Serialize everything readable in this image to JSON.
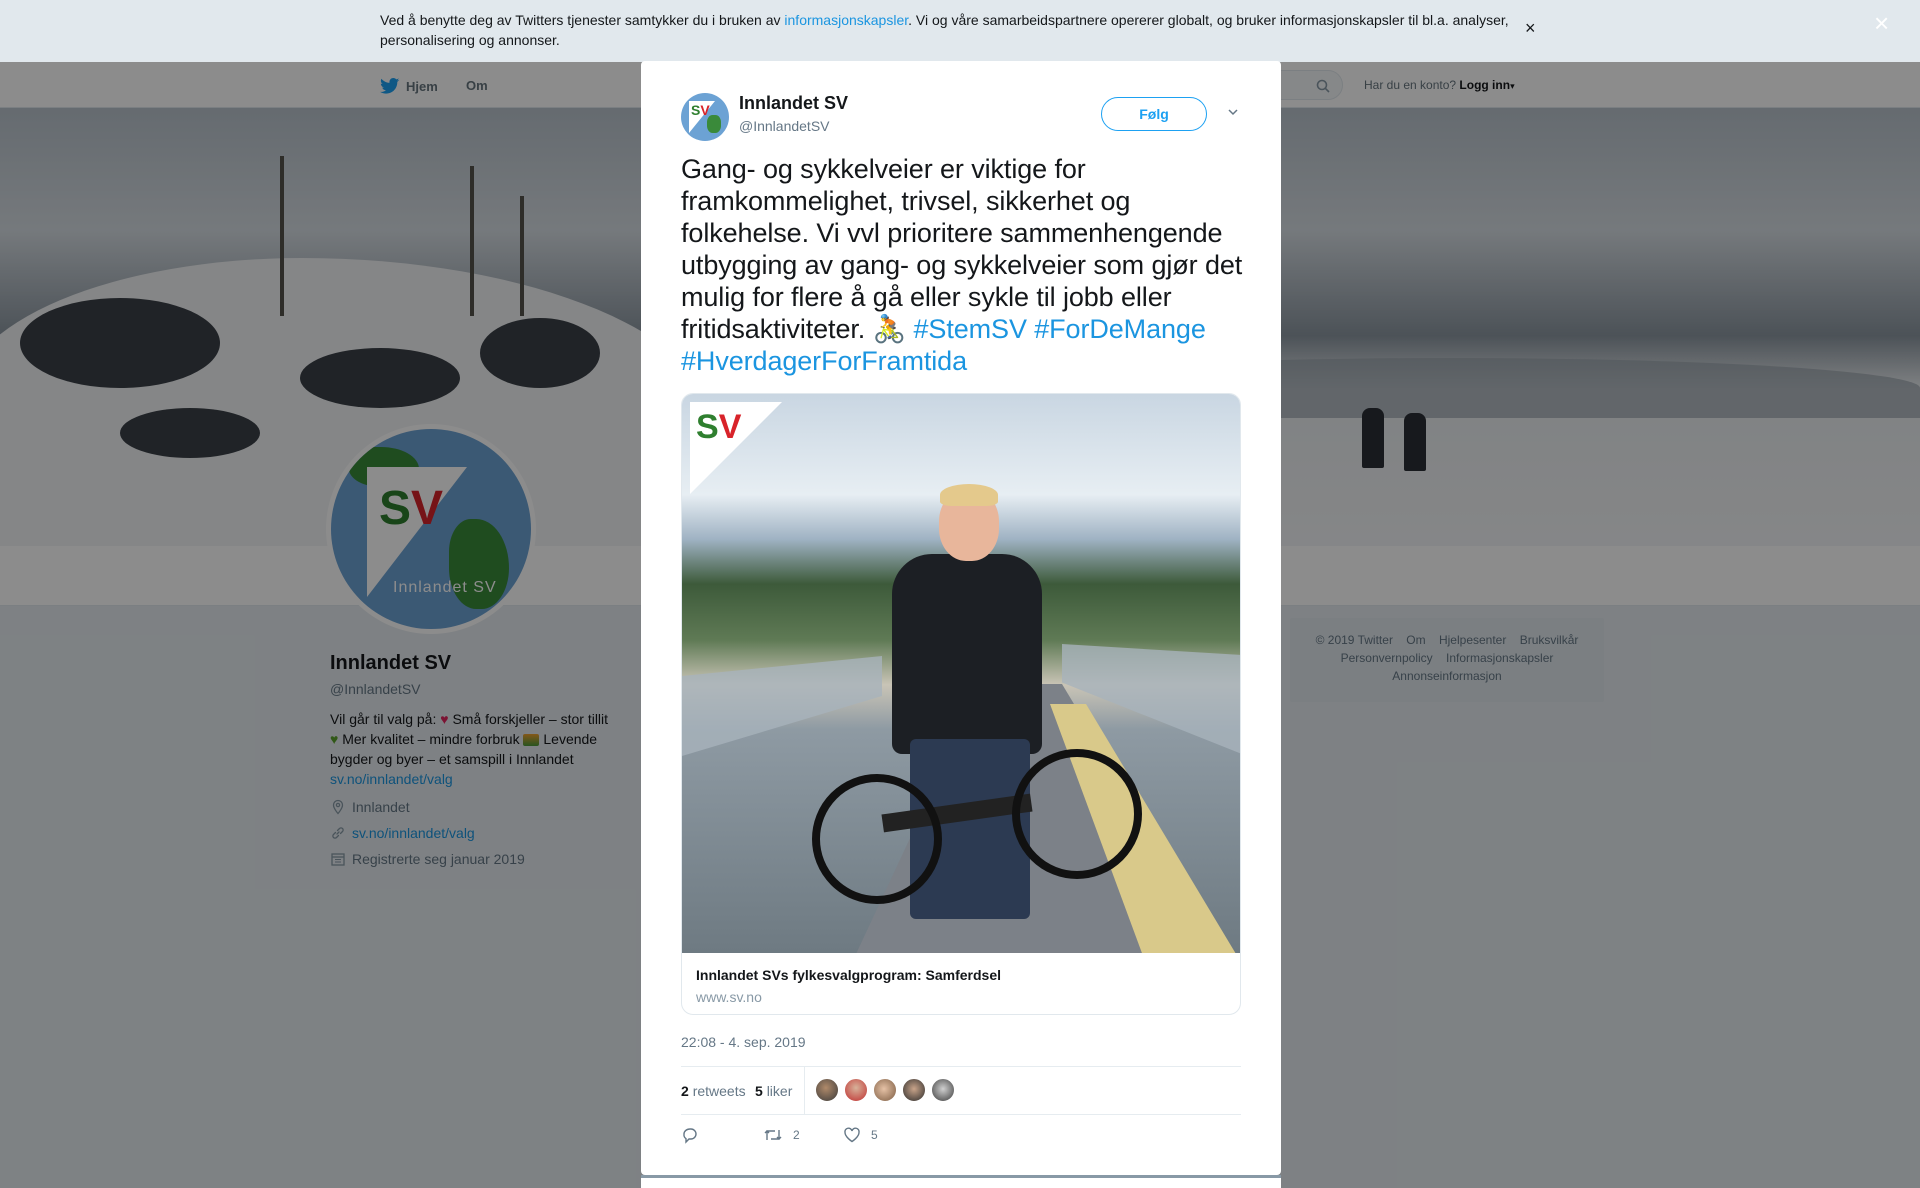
{
  "cookie": {
    "text_before": "Ved å benytte deg av Twitters tjenester samtykker du i bruken av ",
    "link": "informasjonskapsler",
    "text_after": ". Vi og våre samarbeidspartnere opererer globalt, og bruker informasjonskapsler til bl.a. analyser, personalisering og annonser.",
    "close": "×"
  },
  "nav": {
    "home": "Hjem",
    "about": "Om",
    "login_prompt": "Har du en konto?",
    "login": "Logg inn"
  },
  "profile": {
    "avatar_caption": "Innlandet SV",
    "name": "Innlandet SV",
    "handle": "@InnlandetSV",
    "bio_1": "Vil går til valg på: ",
    "bio_2": " Små forskjeller – stor tillit ",
    "bio_3": " Mer kvalitet – mindre forbruk ",
    "bio_4": " Levende bygder og byer – et samspill i Innlandet ",
    "bio_link": "sv.no/innlandet/valg",
    "location": "Innlandet",
    "website": "sv.no/innlandet/valg",
    "joined": "Registrerte seg januar 2019"
  },
  "footer": {
    "copyright": "© 2019 Twitter",
    "about": "Om",
    "help": "Hjelpesenter",
    "terms": "Bruksvilkår",
    "privacy": "Personvernpolicy",
    "cookies": "Informasjonskapsler",
    "ads": "Annonseinformasjon"
  },
  "modal": {
    "close": "×",
    "name": "Innlandet SV",
    "handle": "@InnlandetSV",
    "follow": "Følg",
    "text": "Gang- og sykkelveier er viktige for framkommelighet, trivsel, sikkerhet og folkehelse. Vi vvl prioritere sammenhengende utbygging av gang- og sykkelveier som gjør det mulig for flere å gå eller sykle til jobb eller fritidsaktiviteter. ",
    "emoji": "🚴",
    "hashtags": " #StemSV #ForDeMange #HverdagerForFramtida",
    "card_title": "Innlandet SVs fylkesvalgprogram: Samferdsel",
    "card_url": "www.sv.no",
    "timestamp": "22:08 - 4. sep. 2019",
    "retweets_count": "2",
    "retweets_label": "retweets",
    "likes_count": "5",
    "likes_label": "liker",
    "action_retweets": "2",
    "action_likes": "5"
  }
}
